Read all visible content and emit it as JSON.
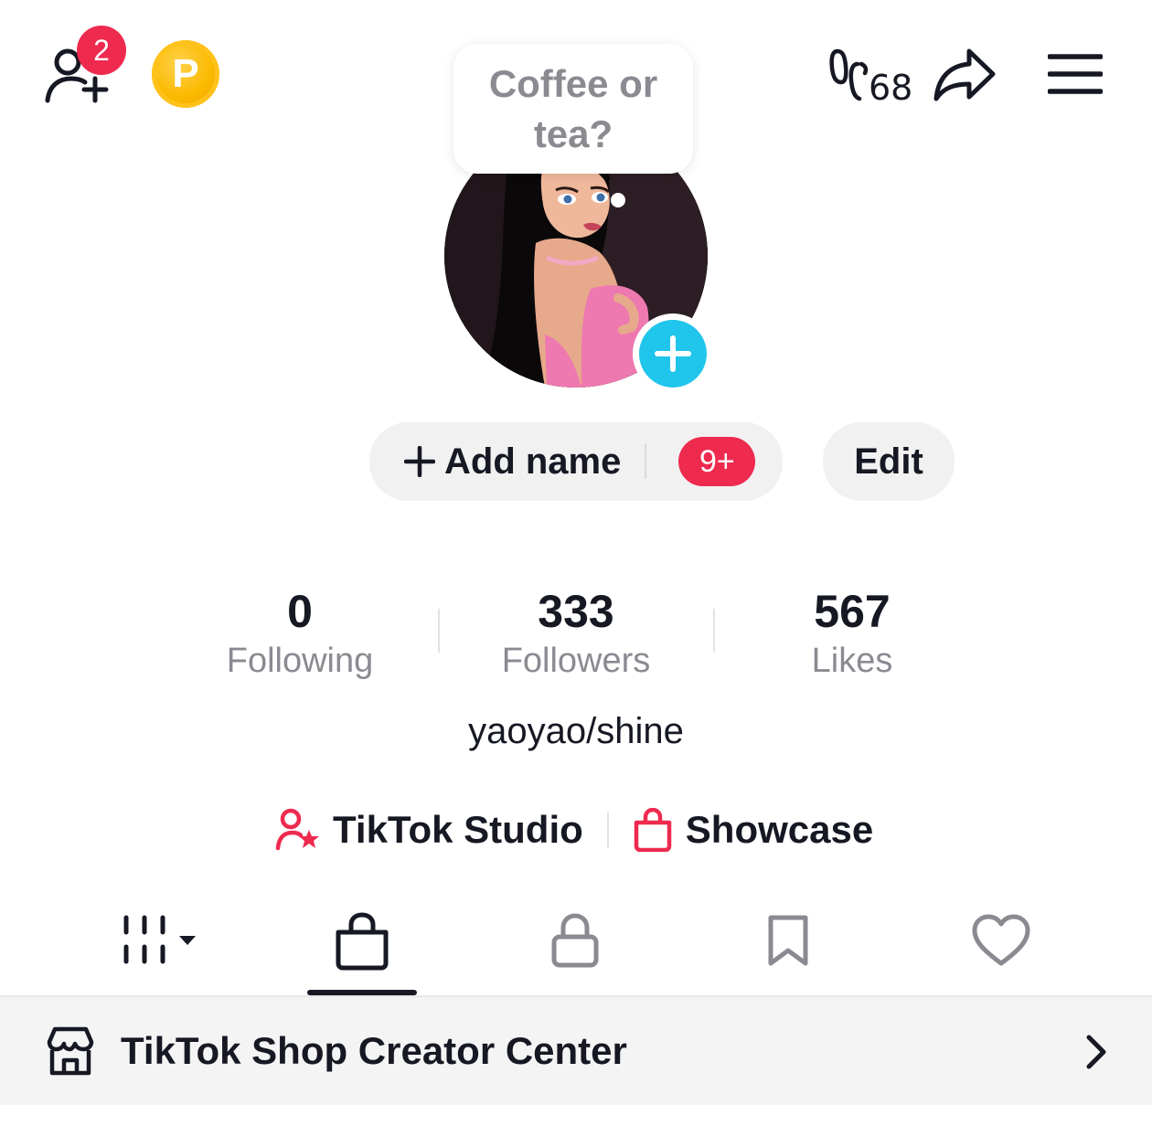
{
  "header": {
    "friend_requests_count": "2",
    "coin_letter": "P",
    "thought_count": "68"
  },
  "bubble": {
    "text": "Coffee or tea?"
  },
  "profile": {
    "add_name_label": "Add name",
    "notification_badge": "9+",
    "edit_label": "Edit",
    "bio": "yaoyao/shine"
  },
  "stats": [
    {
      "value": "0",
      "label": "Following"
    },
    {
      "value": "333",
      "label": "Followers"
    },
    {
      "value": "567",
      "label": "Likes"
    }
  ],
  "links": {
    "studio": "TikTok Studio",
    "showcase": "Showcase"
  },
  "tabs": [
    {
      "icon": "grid-icon",
      "active": false
    },
    {
      "icon": "shopping-bag-icon",
      "active": true
    },
    {
      "icon": "lock-icon",
      "active": false
    },
    {
      "icon": "bookmark-icon",
      "active": false
    },
    {
      "icon": "heart-icon",
      "active": false
    }
  ],
  "shop_row": {
    "label": "TikTok Shop Creator Center"
  },
  "colors": {
    "accent_red": "#ee2a4f",
    "accent_cyan": "#20c5ec",
    "coin_gold": "#fbb900",
    "text_primary": "#161823",
    "text_secondary": "#8a8b91"
  }
}
